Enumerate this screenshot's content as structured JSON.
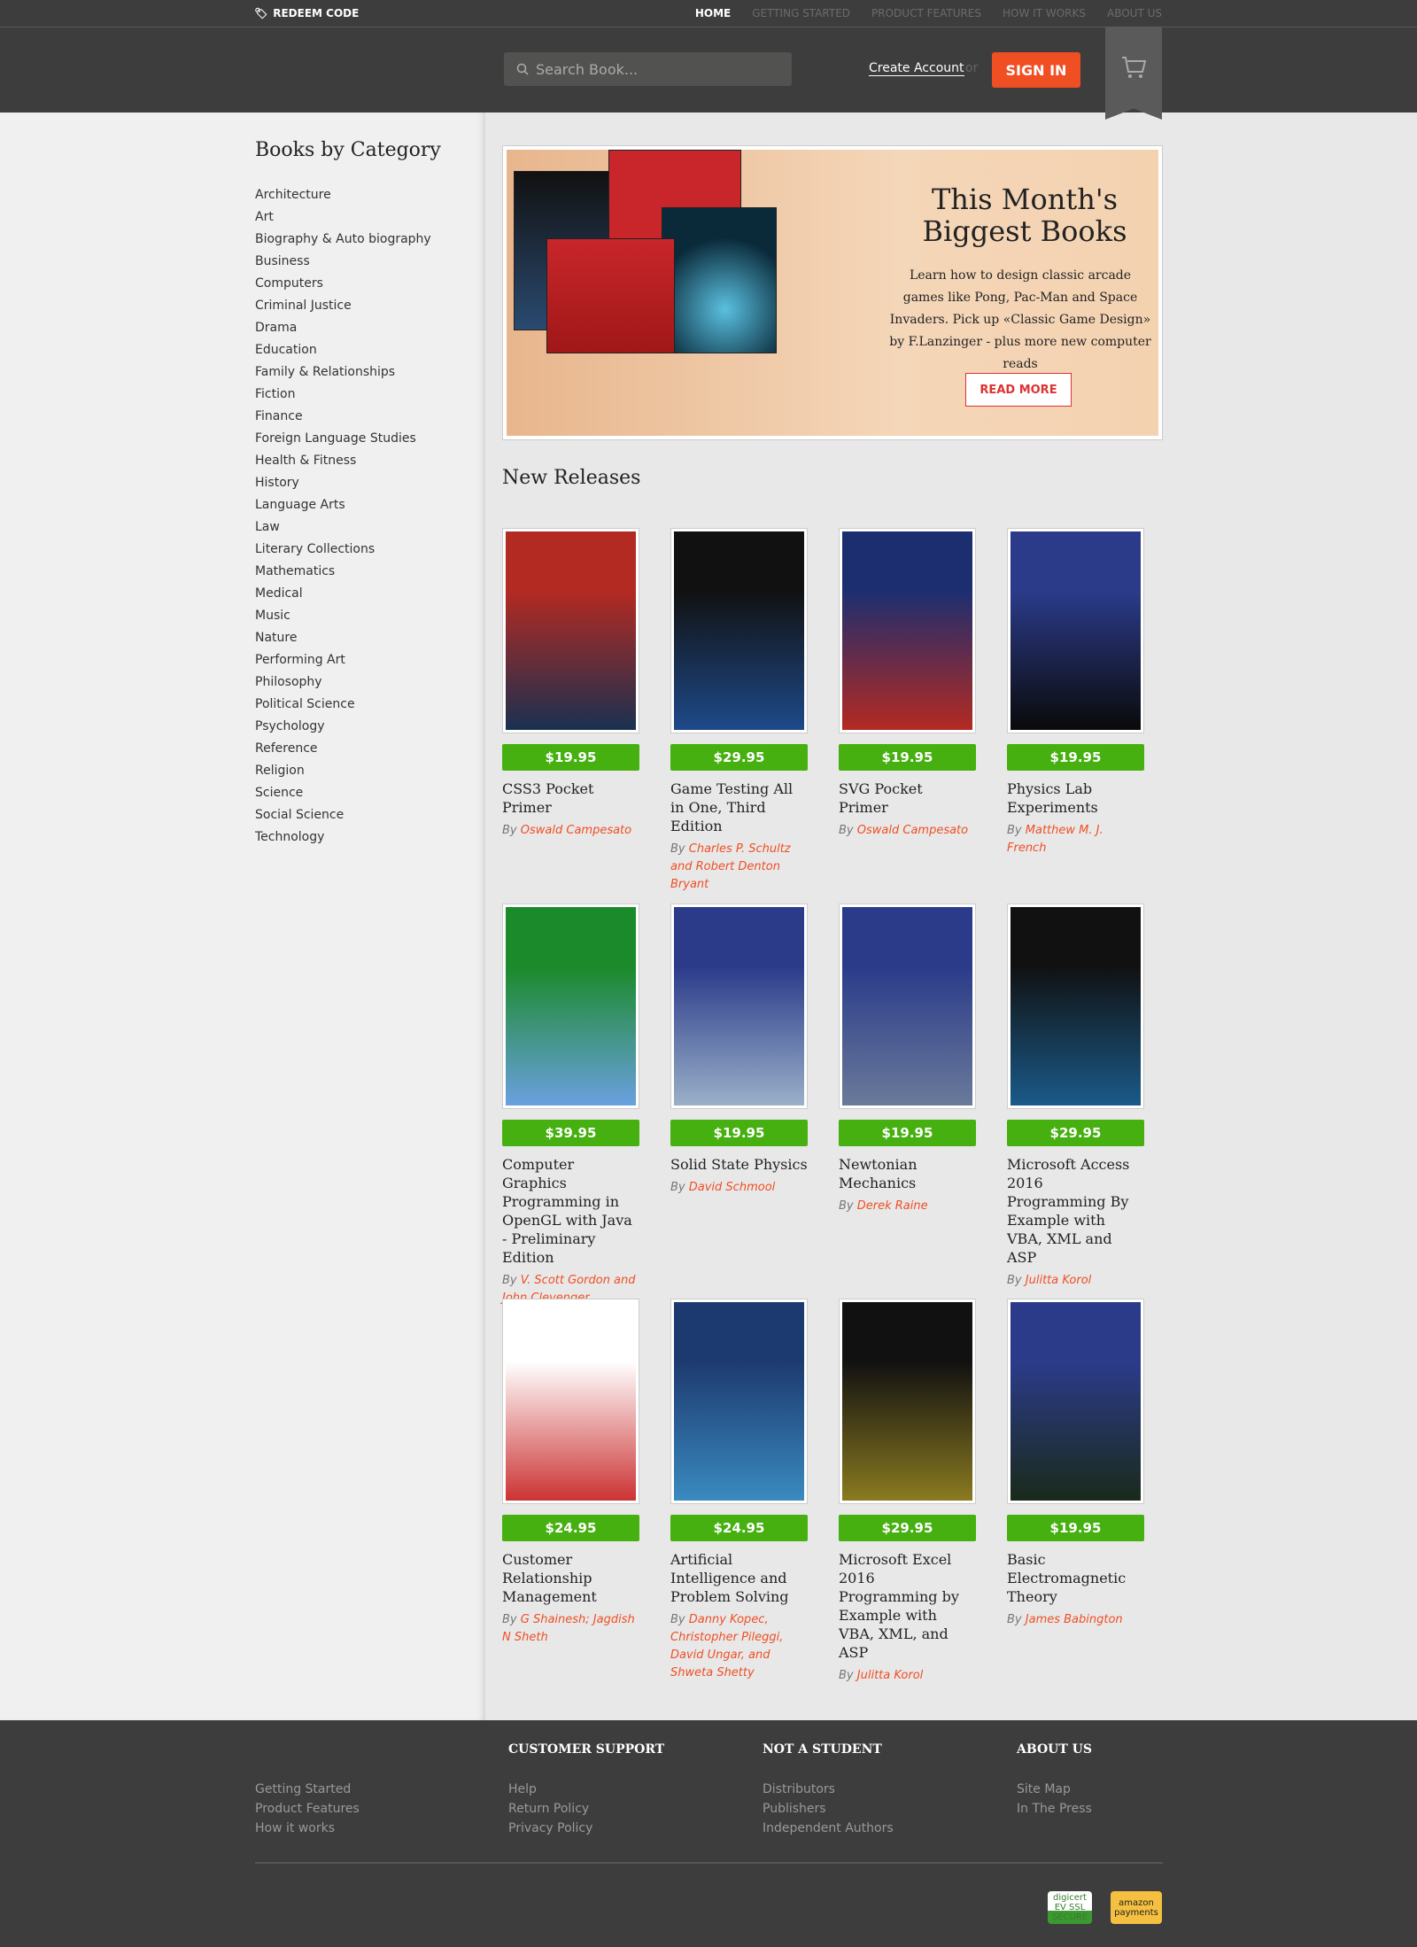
{
  "topbar": {
    "redeem": "REDEEM CODE",
    "nav": [
      "HOME",
      "GETTING STARTED",
      "PRODUCT FEATURES",
      "HOW IT WORKS",
      "ABOUT US"
    ]
  },
  "header": {
    "search_placeholder": "Search Book...",
    "create_account": "Create Account",
    "or": "or",
    "sign_in": "SIGN IN"
  },
  "sidebar": {
    "title": "Books by Category",
    "categories": [
      "Architecture",
      "Art",
      "Biography & Auto biography",
      "Business",
      "Computers",
      "Criminal Justice",
      "Drama",
      "Education",
      "Family & Relationships",
      "Fiction",
      "Finance",
      "Foreign Language Studies",
      "Health & Fitness",
      "History",
      "Language Arts",
      "Law",
      "Literary Collections",
      "Mathematics",
      "Medical",
      "Music",
      "Nature",
      "Performing Art",
      "Philosophy",
      "Political Science",
      "Psychology",
      "Reference",
      "Religion",
      "Science",
      "Social Science",
      "Technology"
    ]
  },
  "banner": {
    "title_line1": "This Month's",
    "title_line2": "Biggest Books",
    "text": "Learn how to design classic arcade games like Pong, Pac-Man and Space Invaders. Pick up «Classic Game Design» by F.Lanzinger - plus more new computer reads",
    "read_more": "READ MORE"
  },
  "new_releases": {
    "title": "New Releases",
    "by": "By",
    "books": [
      {
        "price": "$19.95",
        "title": "CSS3 Pocket Primer",
        "author": "Oswald Campesato",
        "c1": "#b32a22",
        "c2": "#1a3050"
      },
      {
        "price": "$29.95",
        "title": "Game Testing All in One, Third Edition",
        "author": "Charles P. Schultz and Robert Denton Bryant",
        "c1": "#111",
        "c2": "#1e4a8a"
      },
      {
        "price": "$19.95",
        "title": "SVG Pocket Primer",
        "author": "Oswald Campesato",
        "c1": "#1d2e70",
        "c2": "#b32a22"
      },
      {
        "price": "$19.95",
        "title": "Physics Lab Experiments",
        "author": "Matthew M. J. French",
        "c1": "#2b3b8a",
        "c2": "#0a0a0a"
      },
      {
        "price": "$39.95",
        "title": "Computer Graphics Programming in OpenGL with Java - Preliminary Edition",
        "author": "V. Scott Gordon and John Clevenger",
        "c1": "#1b8a2a",
        "c2": "#6aa0e0"
      },
      {
        "price": "$19.95",
        "title": "Solid State Physics",
        "author": "David Schmool",
        "c1": "#2b3b8a",
        "c2": "#9ab0c8"
      },
      {
        "price": "$19.95",
        "title": "Newtonian Mechanics",
        "author": "Derek Raine",
        "c1": "#2b3b8a",
        "c2": "#6a7a9a"
      },
      {
        "price": "$29.95",
        "title": "Microsoft Access 2016 Programming By Example with VBA, XML and ASP",
        "author": "Julitta Korol",
        "c1": "#111",
        "c2": "#1a5a8a"
      },
      {
        "price": "$24.95",
        "title": "Customer Relationship Management",
        "author": "G Shainesh; Jagdish N Sheth",
        "c1": "#fff",
        "c2": "#c33"
      },
      {
        "price": "$24.95",
        "title": "Artificial Intelligence and Problem Solving",
        "author": "Danny Kopec, Christopher Pileggi, David Ungar, and Shweta Shetty",
        "c1": "#1d3a70",
        "c2": "#3a8ac0"
      },
      {
        "price": "$29.95",
        "title": "Microsoft Excel 2016 Programming by Example with VBA, XML, and ASP",
        "author": "Julitta Korol",
        "c1": "#111",
        "c2": "#8a7a20"
      },
      {
        "price": "$19.95",
        "title": "Basic Electromagnetic Theory",
        "author": "James Babington",
        "c1": "#2b3b8a",
        "c2": "#1a2a1a"
      }
    ]
  },
  "footer": {
    "col0": [
      "Getting Started",
      "Product Features",
      "How it works"
    ],
    "col1": {
      "title": "CUSTOMER SUPPORT",
      "links": [
        "Help",
        "Return Policy",
        "Privacy Policy"
      ]
    },
    "col2": {
      "title": "NOT A STUDENT",
      "links": [
        "Distributors",
        "Publishers",
        "Independent Authors"
      ]
    },
    "col3": {
      "title": "ABOUT US",
      "links": [
        "Site Map",
        "In The Press"
      ]
    },
    "badges": [
      "digicert EV SSL SECURE",
      "amazon payments"
    ]
  },
  "colors": {
    "accent": "#f04e23",
    "price": "#46b010",
    "dark": "#3d3d3d"
  }
}
